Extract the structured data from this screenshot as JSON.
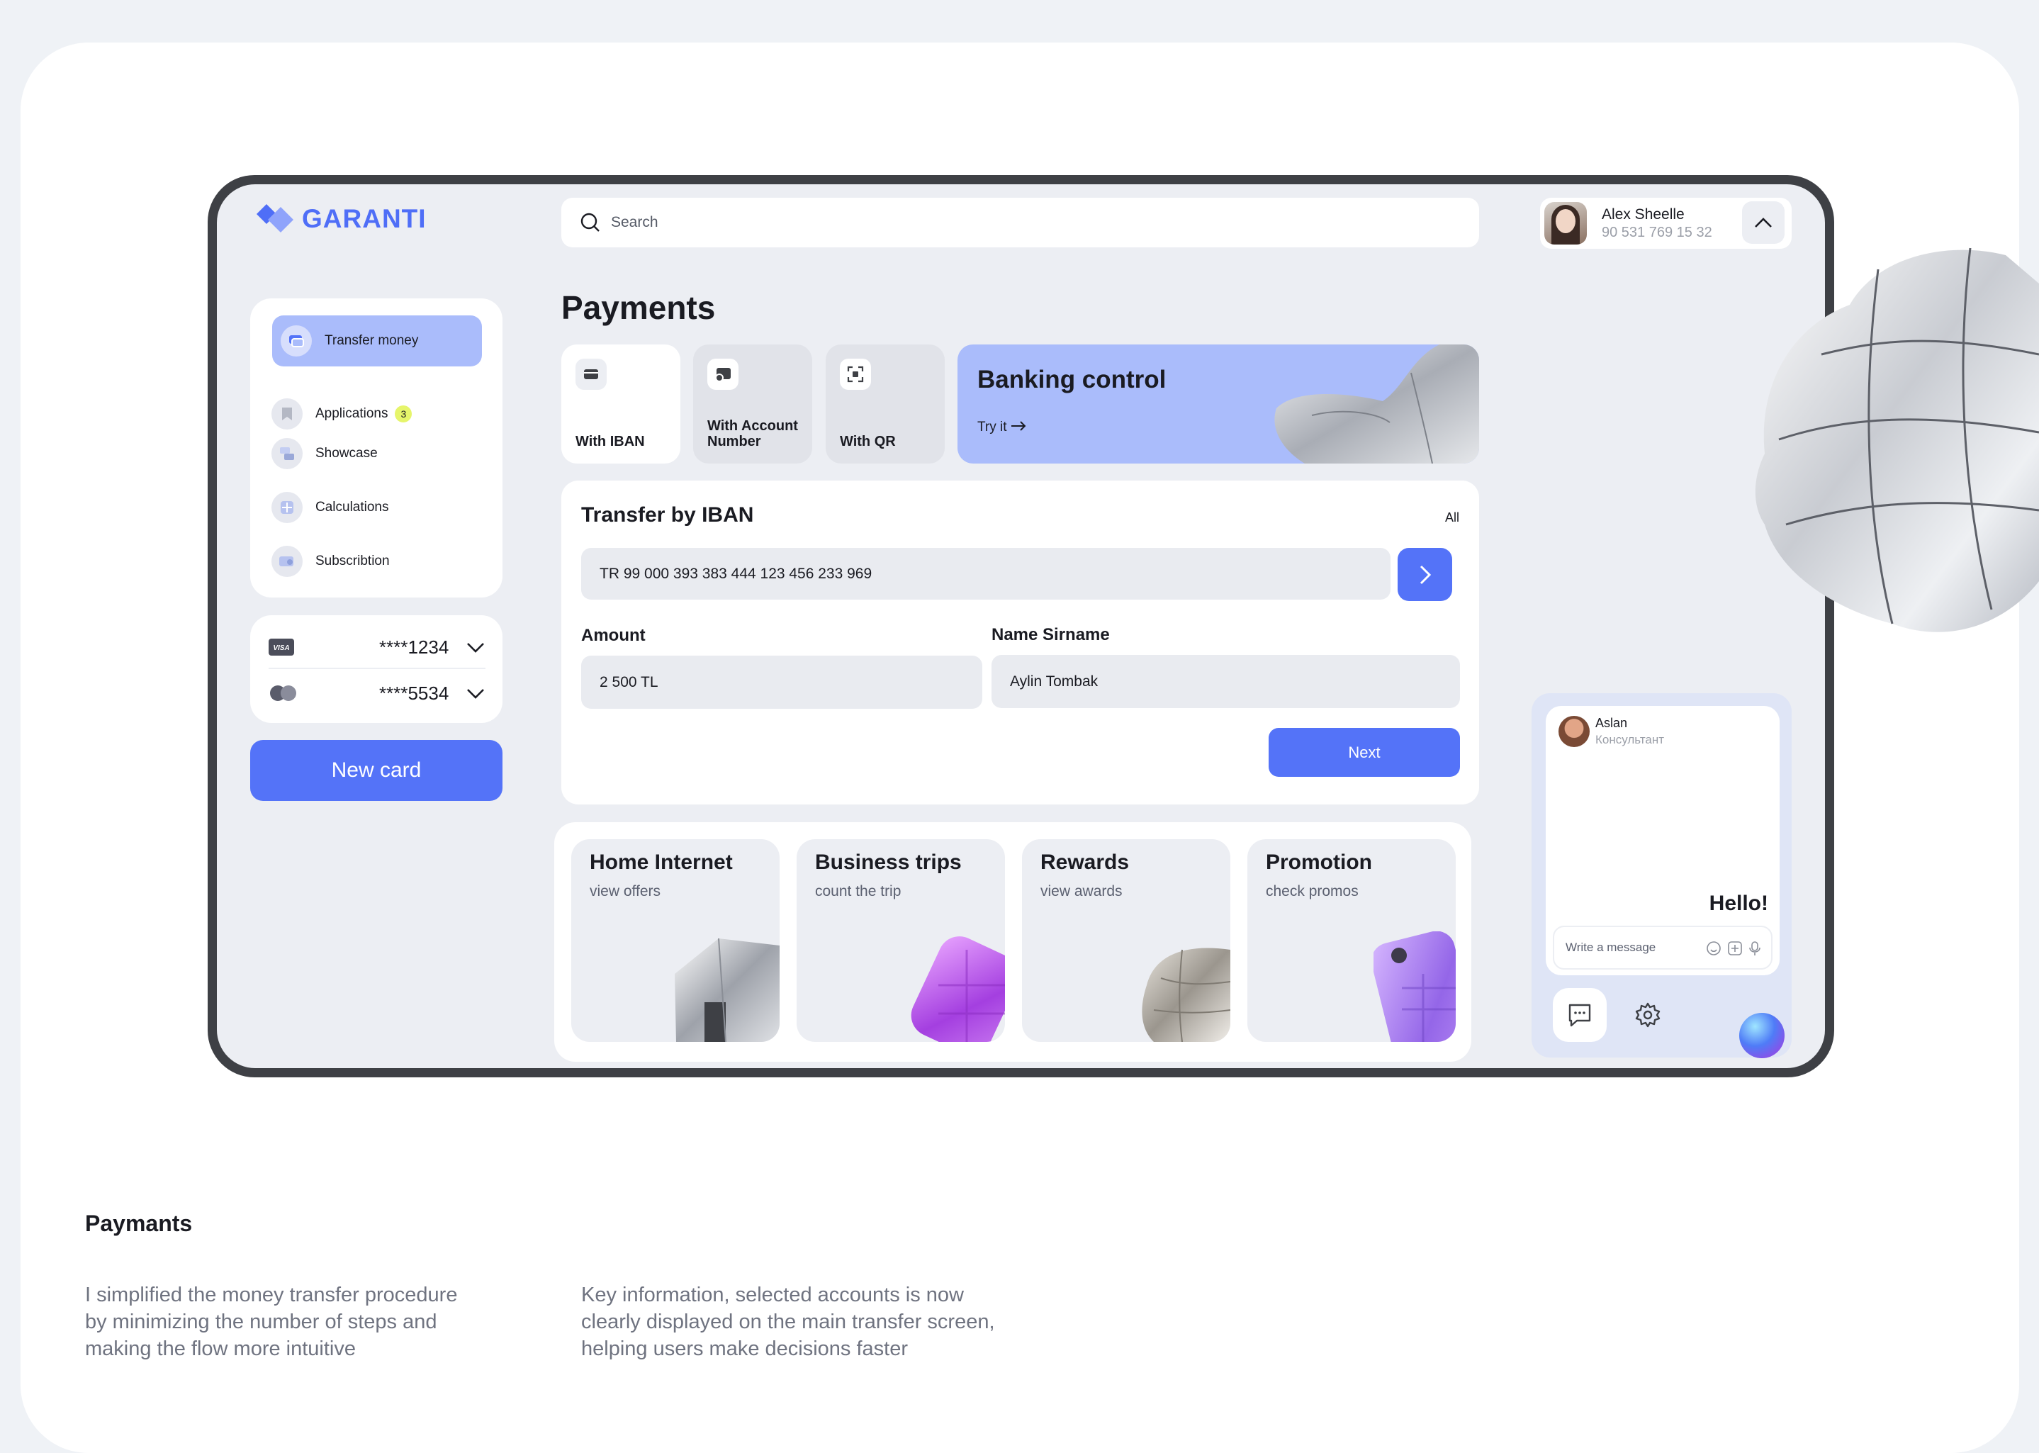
{
  "brand": {
    "name": "GARANTI",
    "color": "#4f6ef7",
    "icon": "garanti-diamond-logo"
  },
  "search": {
    "placeholder": "Search",
    "icon": "search-icon"
  },
  "profile": {
    "name": "Alex Sheelle",
    "phone": "90 531 769 15 32"
  },
  "menu": {
    "items": [
      {
        "label": "Transfer money",
        "icon": "transfer-icon",
        "active": true
      },
      {
        "label": "Applications",
        "icon": "bookmark-icon",
        "badge": "3"
      },
      {
        "label": "Showcase",
        "icon": "showcase-icon"
      },
      {
        "label": "Calculations",
        "icon": "calculator-icon"
      },
      {
        "label": "Subscribtion",
        "icon": "subscription-icon"
      }
    ]
  },
  "cards": [
    {
      "brand": "VISA",
      "number": "****1234"
    },
    {
      "brand": "mastercard",
      "number": "****5534"
    }
  ],
  "new_card_label": "New card",
  "page_title": "Payments",
  "methods": [
    {
      "label": "With IBAN",
      "icon": "card-icon",
      "selected": true
    },
    {
      "label": "With Account Number",
      "icon": "account-icon"
    },
    {
      "label": "With QR",
      "icon": "qr-scan-icon"
    }
  ],
  "banner": {
    "title": "Banking control",
    "action": "Try it"
  },
  "transfer": {
    "title": "Transfer by IBAN",
    "all_link": "All",
    "iban": "TR 99 000 393 383 444 123 456 233 969",
    "amount_label": "Amount",
    "amount": "2 500 TL",
    "name_label": "Name Sirname",
    "name": "Aylin Tombak",
    "next_label": "Next"
  },
  "offers": [
    {
      "title": "Home Internet",
      "subtitle": "view offers"
    },
    {
      "title": "Business trips",
      "subtitle": "count the trip"
    },
    {
      "title": "Rewards",
      "subtitle": "view awards"
    },
    {
      "title": "Promotion",
      "subtitle": "check promos"
    }
  ],
  "chat": {
    "name": "Aslan",
    "role": "Консультант",
    "greeting": "Hello!",
    "placeholder": "Write a message"
  },
  "caption": {
    "title": "Paymants",
    "col1": "I simplified the money transfer procedure by minimizing the number of steps and making the flow more intuitive",
    "col2": "Key information, selected accounts is now clearly displayed on the main transfer screen, helping users make decisions faster"
  },
  "colors": {
    "accent": "#5473f8",
    "banner": "#aabcfb",
    "background": "#eceef3",
    "badge": "#e6f56b"
  }
}
